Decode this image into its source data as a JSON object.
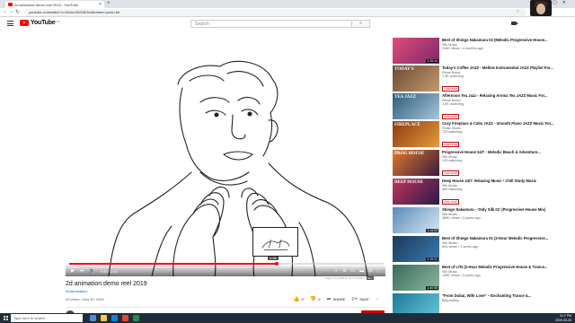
{
  "browser": {
    "tab_title": "2d animation demo reel 2019 - YouTube",
    "address": "youtube.com/watch?v=9ddvL0WG8Os&feature=youtu.be"
  },
  "masthead": {
    "logo_text": "YouTube",
    "logo_region": "CA",
    "search_placeholder": "Search"
  },
  "player": {
    "current_time": "0:40",
    "duration": "1:01",
    "time_display": "0:40 / 1:01",
    "preview_time": "0:55",
    "progress_fraction": 0.66
  },
  "video": {
    "title": "2d animation demo reel 2019",
    "hashtag": "#2dAnimation",
    "views": "53 views",
    "date": "Mar 30, 2020",
    "meta": "53 views • Mar 30, 2020",
    "likes": "0",
    "dislikes": "0",
    "share_label": "SHARE",
    "save_label": "SAVE",
    "watermark_text": "clipped by AdBlock for YouTube™",
    "watermark_badge": "Gen"
  },
  "related": [
    {
      "title": "Best of Shingo Nakamura 03 (Melodic Progressive House...",
      "channel": "Silk Music",
      "views": "216K views • 4 months ago",
      "duration": "1:26:14",
      "live": false,
      "colors": [
        "#e34a7a",
        "#7b2a6b"
      ],
      "overlay": ""
    },
    {
      "title": "Today's Coffee JAZZ - Mellow Instrumental JAZZ Playlist For...",
      "channel": "Relax Music",
      "views": "1.3K watching",
      "duration": "",
      "live": true,
      "live_label": "LIVE NOW",
      "colors": [
        "#6b4a34",
        "#c49a6c"
      ],
      "overlay": "TODAY'S"
    },
    {
      "title": "Afternoon Tea Jazz - Relaxing Aroma Tea JAZZ Music For...",
      "channel": "Relax Music",
      "views": "1.3K watching",
      "duration": "",
      "live": true,
      "live_label": "LIVE NOW",
      "colors": [
        "#2d5b7a",
        "#a6c6d8"
      ],
      "overlay": "TEA JAZZ"
    },
    {
      "title": "Cozy Fireplace & Calm JAZZ - Smooth Piano JAZZ Music For...",
      "channel": "Relax Music",
      "views": "725 watching",
      "duration": "",
      "live": true,
      "live_label": "LIVE NOW",
      "colors": [
        "#8a3a12",
        "#e89a3c"
      ],
      "overlay": "FIREPLACE"
    },
    {
      "title": "Progressive House 24/7 : Melodic Beach & Adventure...",
      "channel": "Silk Music",
      "views": "125 watching",
      "duration": "",
      "live": true,
      "live_label": "LIVE NOW",
      "colors": [
        "#e07a2c",
        "#3a1a3a"
      ],
      "overlay": "PROG HOUSE"
    },
    {
      "title": "Deep House 24/7: Relaxing Music • Chill Study Music",
      "channel": "Silk Music",
      "views": "463 watching",
      "duration": "",
      "live": true,
      "live_label": "LIVE NOW",
      "colors": [
        "#c2345a",
        "#2a1a4a"
      ],
      "overlay": "DEEP HOUSE"
    },
    {
      "title": "Shingo Nakamura - 'Only Silk 01' (Progressive House Mix)",
      "channel": "Silk Music",
      "views": "385K views • 3 years ago",
      "duration": "1:14:03",
      "live": false,
      "colors": [
        "#5a8ab8",
        "#d8e8f4"
      ],
      "overlay": ""
    },
    {
      "title": "Best of Shingo Nakamura 01 (2-Hour Melodic Progressive...",
      "channel": "Silk Music",
      "views": "844 views • 3 years ago",
      "duration": "2:15:21",
      "live": false,
      "colors": [
        "#1a3a5a",
        "#3a7ab0"
      ],
      "overlay": ""
    },
    {
      "title": "Best of LTN (2-Hour Melodic Progressive House & Trance...",
      "channel": "Silk Music",
      "views": "135K views • 3 years ago",
      "duration": "1:40:55",
      "live": false,
      "colors": [
        "#3a6a5a",
        "#8ab8a0"
      ],
      "overlay": ""
    },
    {
      "title": "\"From Dubai, With Love\" – Enchanting Trance &...",
      "channel": "BeyondSky",
      "views": "",
      "duration": "",
      "live": false,
      "colors": [
        "#1a7a9a",
        "#6ac8d8"
      ],
      "overlay": ""
    }
  ],
  "taskbar": {
    "search_placeholder": "Type here to search",
    "time": "3:17 PM",
    "date": "2020-03-30"
  }
}
